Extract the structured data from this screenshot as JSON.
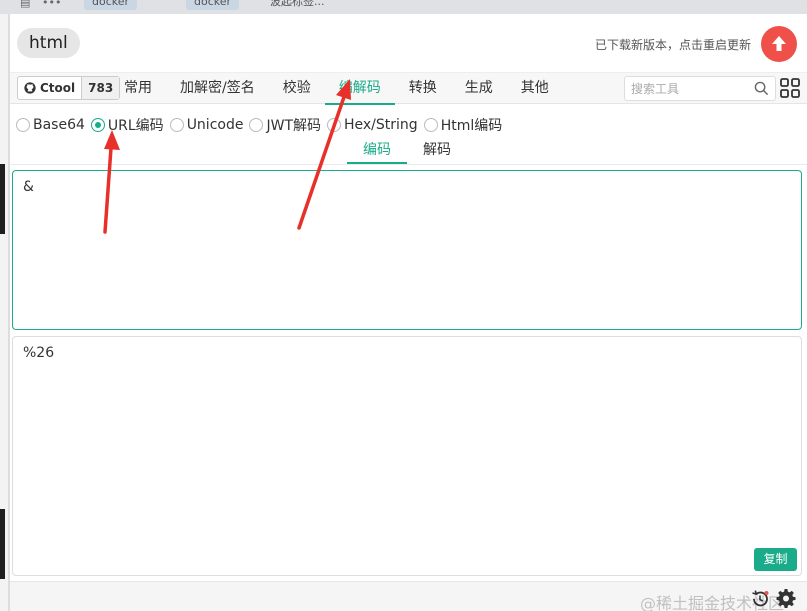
{
  "browser": {
    "tabs": [
      "docker",
      "docker",
      "波起标签..."
    ]
  },
  "header": {
    "title": "html",
    "update_text": "已下载新版本，点击重启更新"
  },
  "toolbar": {
    "brand_name": "Ctool",
    "brand_count": "783",
    "tabs": [
      {
        "label": "常用"
      },
      {
        "label": "加解密/签名"
      },
      {
        "label": "校验"
      },
      {
        "label": "编解码"
      },
      {
        "label": "转换"
      },
      {
        "label": "生成"
      },
      {
        "label": "其他"
      }
    ],
    "active_tab": "编解码",
    "search_placeholder": "搜索工具"
  },
  "tools": {
    "options": [
      "Base64",
      "URL编码",
      "Unicode",
      "JWT解码",
      "Hex/String",
      "Html编码"
    ],
    "selected": "URL编码"
  },
  "subtabs": {
    "items": [
      "编码",
      "解码"
    ],
    "active": "编码"
  },
  "input": {
    "value": "&"
  },
  "output": {
    "value": "%26",
    "copy_label": "复制"
  },
  "footer": {
    "watermark": "@稀土掘金技术社区"
  },
  "colors": {
    "accent": "#1aab8a",
    "update": "#f0504a",
    "annotation": "#e8302a"
  }
}
